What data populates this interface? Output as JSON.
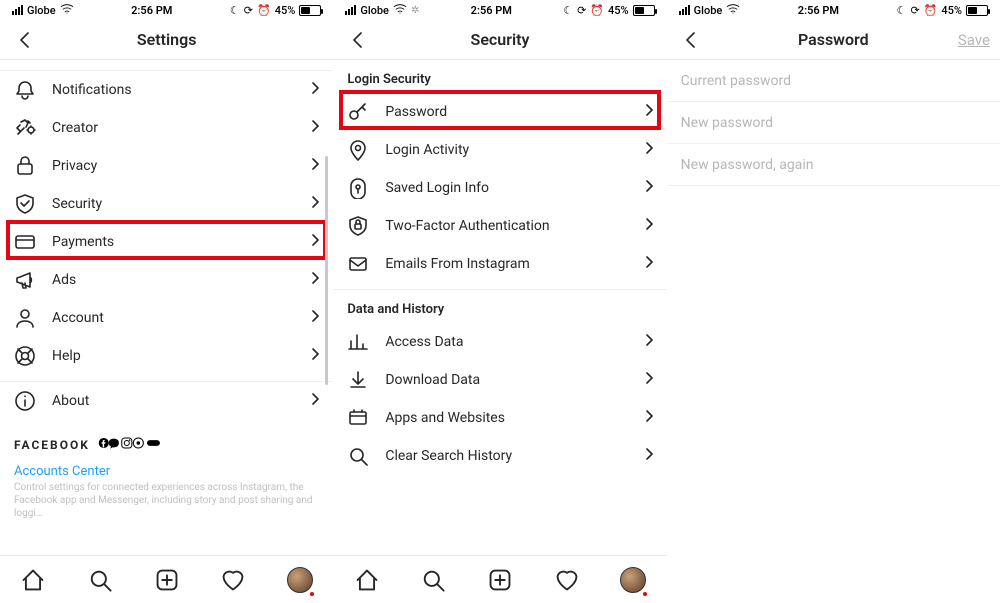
{
  "status": {
    "carrier": "Globe",
    "time": "2:56 PM",
    "battery_pct": "45%"
  },
  "screen1": {
    "title": "Settings",
    "items": [
      {
        "label": "Notifications",
        "icon": "bell-icon"
      },
      {
        "label": "Creator",
        "icon": "creator-icon"
      },
      {
        "label": "Privacy",
        "icon": "lock-icon"
      },
      {
        "label": "Security",
        "icon": "shield-icon",
        "highlight": true
      },
      {
        "label": "Payments",
        "icon": "card-icon"
      },
      {
        "label": "Ads",
        "icon": "megaphone-icon"
      },
      {
        "label": "Account",
        "icon": "user-icon"
      },
      {
        "label": "Help",
        "icon": "lifebuoy-icon"
      },
      {
        "label": "About",
        "icon": "info-icon"
      }
    ],
    "footer_brand": "FACEBOOK",
    "accounts_center": "Accounts Center",
    "footnote": "Control settings for connected experiences across Instagram, the Facebook app and Messenger, including story and post sharing and loggi…"
  },
  "screen2": {
    "title": "Security",
    "section_login": "Login Security",
    "section_data": "Data and History",
    "login_items": [
      {
        "label": "Password",
        "icon": "key-icon",
        "highlight": true
      },
      {
        "label": "Login Activity",
        "icon": "pin-icon"
      },
      {
        "label": "Saved Login Info",
        "icon": "keyhole-icon"
      },
      {
        "label": "Two-Factor Authentication",
        "icon": "shield2-icon"
      },
      {
        "label": "Emails From Instagram",
        "icon": "mail-icon"
      }
    ],
    "data_items": [
      {
        "label": "Access Data",
        "icon": "bars-icon"
      },
      {
        "label": "Download Data",
        "icon": "download-icon"
      },
      {
        "label": "Apps and Websites",
        "icon": "apps-icon"
      },
      {
        "label": "Clear Search History",
        "icon": "search-icon"
      }
    ]
  },
  "screen3": {
    "title": "Password",
    "save": "Save",
    "fields": {
      "current": "Current password",
      "new": "New password",
      "again": "New password, again"
    }
  }
}
